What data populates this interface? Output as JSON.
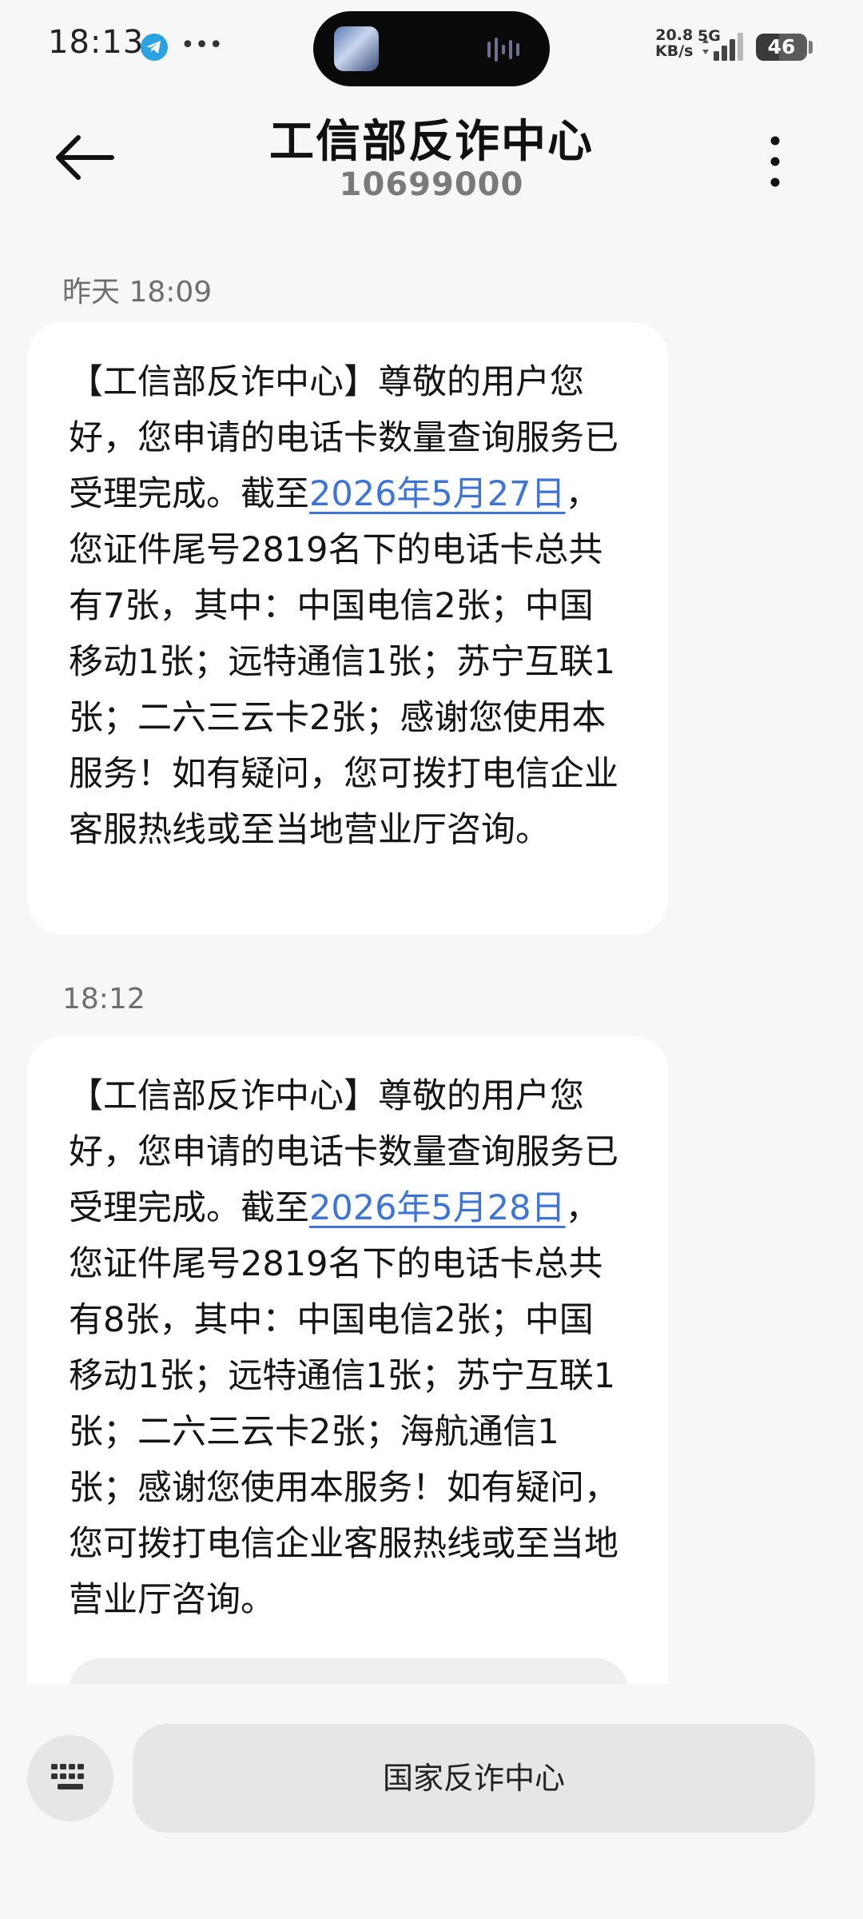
{
  "status_bar": {
    "time": "18:13",
    "net_speed_value": "20.8",
    "net_speed_unit": "KB/s",
    "network_type": "5G",
    "battery": "46",
    "battery_level_pct": 46,
    "icons": [
      "telegram-icon",
      "more-dots-icon",
      "signal-icon",
      "battery-icon",
      "audio-wave-icon"
    ]
  },
  "header": {
    "title": "工信部反诈中心",
    "sender_number": "10699000"
  },
  "messages": [
    {
      "timestamp": "昨天 18:09",
      "text_before": "【工信部反诈中心】尊敬的用户您好，您申请的电话卡数量查询服务已受理完成。截至",
      "date_link": "2026年5月27日",
      "text_after": "，您证件尾号2819名下的电话卡总共有7张，其中：中国电信2张；中国移动1张；远特通信1张；苏宁互联1张；二六三云卡2张；感谢您使用本服务！如有疑问，您可拨打电信企业客服热线或至当地营业厅咨询。"
    },
    {
      "timestamp": "18:12",
      "text_before": "【工信部反诈中心】尊敬的用户您好，您申请的电话卡数量查询服务已受理完成。截至",
      "date_link": "2026年5月28日",
      "text_after": "，您证件尾号2819名下的电话卡总共有8张，其中：中国电信2张；中国移动1张；远特通信1张；苏宁互联1张；二六三云卡2张；海航通信1张；感谢您使用本服务！如有疑问，您可拨打电信企业客服热线或至当地营业厅咨询。"
    }
  ],
  "bottom": {
    "quick_reply_label": "国家反诈中心"
  }
}
